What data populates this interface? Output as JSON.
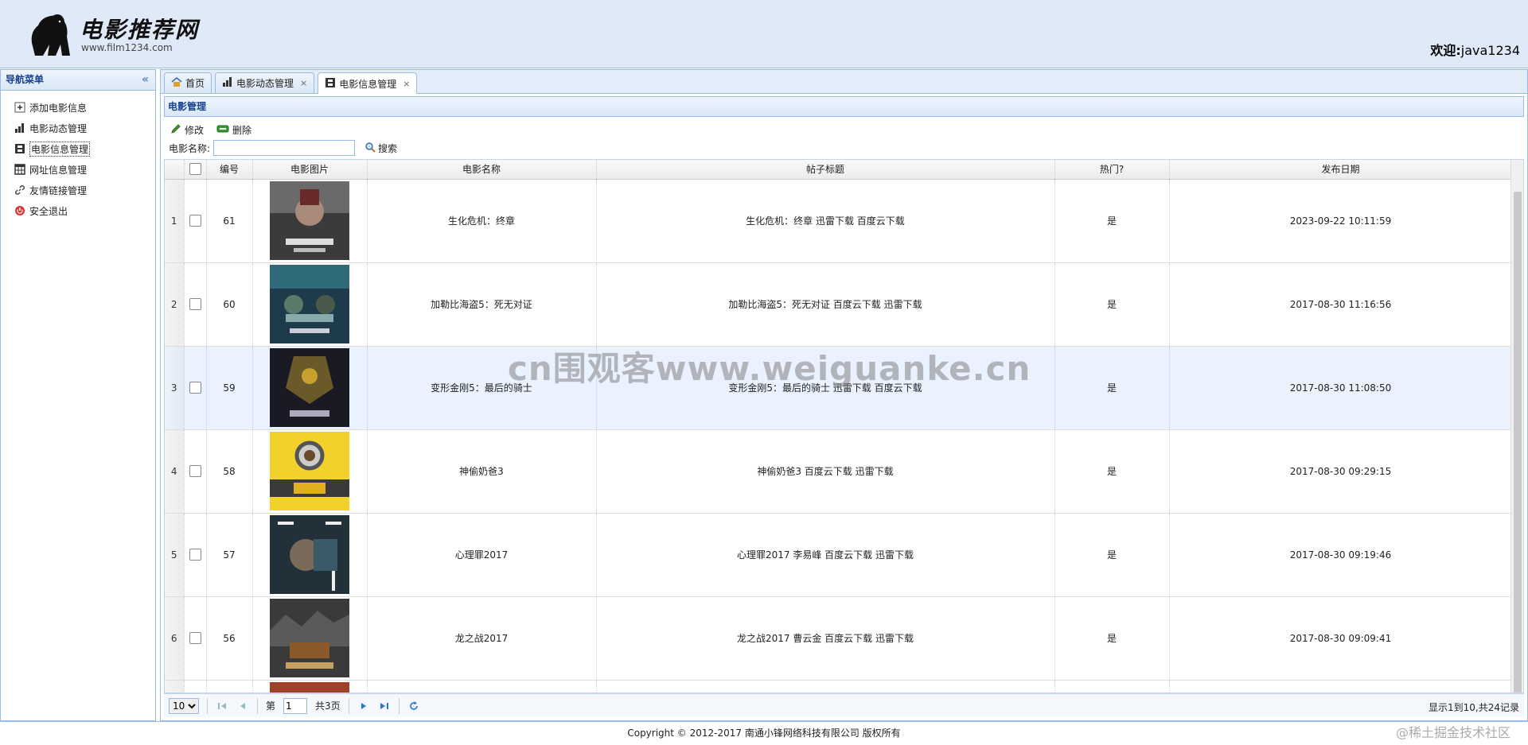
{
  "header": {
    "site_title": "电影推荐网",
    "site_url": "www.film1234.com",
    "welcome_label": "欢迎:",
    "username": "java1234"
  },
  "sidebar": {
    "title": "导航菜单",
    "items": [
      {
        "label": "添加电影信息",
        "icon": "add-icon"
      },
      {
        "label": "电影动态管理",
        "icon": "bar-chart-icon"
      },
      {
        "label": "电影信息管理",
        "icon": "film-icon"
      },
      {
        "label": "网址信息管理",
        "icon": "table-icon"
      },
      {
        "label": "友情链接管理",
        "icon": "link-icon"
      },
      {
        "label": "安全退出",
        "icon": "exit-icon"
      }
    ]
  },
  "tabs": [
    {
      "label": "首页"
    },
    {
      "label": "电影动态管理"
    },
    {
      "label": "电影信息管理"
    }
  ],
  "panel": {
    "title": "电影管理"
  },
  "toolbar": {
    "edit_label": "修改",
    "delete_label": "删除"
  },
  "search": {
    "label": "电影名称:",
    "value": "",
    "button": "搜索"
  },
  "table": {
    "headers": [
      "编号",
      "电影图片",
      "电影名称",
      "帖子标题",
      "热门?",
      "发布日期"
    ],
    "rows": [
      {
        "rownum": "1",
        "id": "61",
        "name": "生化危机：终章",
        "title": "生化危机：终章 迅雷下载 百度云下载",
        "hot": "是",
        "date": "2023-09-22 10:11:59"
      },
      {
        "rownum": "2",
        "id": "60",
        "name": "加勒比海盗5：死无对证",
        "title": "加勒比海盗5：死无对证 百度云下载 迅雷下载",
        "hot": "是",
        "date": "2017-08-30 11:16:56"
      },
      {
        "rownum": "3",
        "id": "59",
        "name": "变形金刚5：最后的骑士",
        "title": "变形金刚5：最后的骑士 迅雷下载 百度云下载",
        "hot": "是",
        "date": "2017-08-30 11:08:50"
      },
      {
        "rownum": "4",
        "id": "58",
        "name": "神偷奶爸3",
        "title": "神偷奶爸3 百度云下载 迅雷下载",
        "hot": "是",
        "date": "2017-08-30 09:29:15"
      },
      {
        "rownum": "5",
        "id": "57",
        "name": "心理罪2017",
        "title": "心理罪2017 李易峰 百度云下载 迅雷下载",
        "hot": "是",
        "date": "2017-08-30 09:19:46"
      },
      {
        "rownum": "6",
        "id": "56",
        "name": "龙之战2017",
        "title": "龙之战2017 曹云金 百度云下载 迅雷下载",
        "hot": "是",
        "date": "2017-08-30 09:09:41"
      }
    ]
  },
  "pager": {
    "page_size": "10",
    "page_prefix": "第",
    "page": "1",
    "page_suffix": "共3页",
    "info": "显示1到10,共24记录"
  },
  "footer": {
    "copyright": "Copyright © 2012-2017 南通小锋网络科技有限公司 版权所有",
    "community_mark": "@稀土掘金技术社区"
  },
  "watermark": "cn围观客www.weiguanke.cn",
  "colors": {
    "header_bg": "#dfe9f8",
    "border": "#99bbe8",
    "panel_title": "#15428b",
    "row_highlight": "#eaf2ff"
  }
}
